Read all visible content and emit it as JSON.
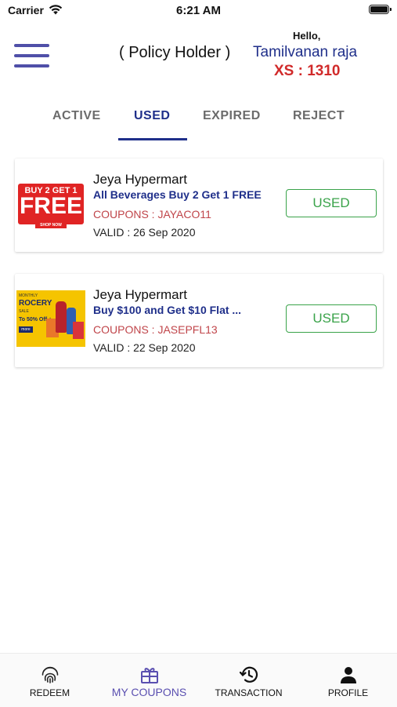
{
  "status_bar": {
    "carrier": "Carrier",
    "time": "6:21 AM",
    "icons": [
      "wifi-icon",
      "battery-icon"
    ]
  },
  "header": {
    "menu_icon": "hamburger-menu-icon",
    "policy_label": "( Policy Holder )",
    "greeting": "Hello,",
    "user_name": "Tamilvanan raja",
    "points": "XS : 1310"
  },
  "tabs": [
    {
      "label": "ACTIVE"
    },
    {
      "label": "USED"
    },
    {
      "label": "EXPIRED"
    },
    {
      "label": "REJECT"
    }
  ],
  "active_tab": "USED",
  "coupons": [
    {
      "store": "Jeya Hypermart",
      "title": "All Beverages Buy 2 Get 1 FREE",
      "code": "COUPONS : JAYACO11",
      "valid": "VALID : 26 Sep 2020",
      "status": "USED",
      "image_text": {
        "line1": "BUY 2 GET 1",
        "line2": "FREE",
        "button": "SHOP NOW"
      }
    },
    {
      "store": "Jeya Hypermart",
      "title": "Buy $100 and Get $10 Flat ...",
      "code": "COUPONS : JASEPFL13",
      "valid": "VALID : 22 Sep 2020",
      "status": "USED",
      "image_text": {
        "line1": "MONTHLY",
        "line2": "ROCERY",
        "line3": "SALE",
        "line4": "To 50% Off +",
        "line5": "more"
      }
    }
  ],
  "bottom_nav": [
    {
      "label": "REDEEM",
      "icon": "fingerprint-icon"
    },
    {
      "label": "MY COUPONS",
      "icon": "gift-icon"
    },
    {
      "label": "TRANSACTION",
      "icon": "history-icon"
    },
    {
      "label": "PROFILE",
      "icon": "person-icon"
    }
  ],
  "active_nav": "MY COUPONS",
  "colors": {
    "brand_blue": "#1f2f8a",
    "accent_purple": "#5a4fb0",
    "points_red": "#d12a2a",
    "used_green": "#3aa34a",
    "code_red": "#c0454a"
  }
}
